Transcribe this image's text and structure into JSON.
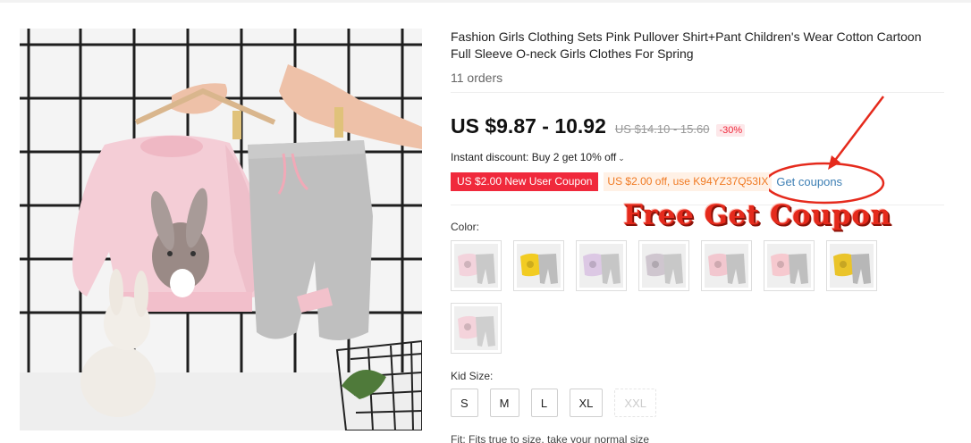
{
  "product": {
    "title": "Fashion Girls Clothing Sets Pink Pullover Shirt+Pant Children's Wear Cotton Cartoon Full Sleeve O-neck Girls Clothes For Spring",
    "orders": "11 orders"
  },
  "price": {
    "current": "US $9.87 - 10.92",
    "original": "US $14.10 - 15.60",
    "discount": "-30%"
  },
  "instant_discount": {
    "text": "Instant discount: Buy 2 get 10% off",
    "caret": "⌄"
  },
  "coupons": {
    "new_user": "US $2.00 New User Coupon",
    "code_offer": "US $2.00 off, use K94YZ37Q53IX",
    "get_coupons": "Get coupons"
  },
  "color": {
    "label": "Color:",
    "options": [
      {
        "name": "pink-rabbit",
        "top": "#f3d3dc",
        "pant": "#c9c9c9"
      },
      {
        "name": "yellow-cat",
        "top": "#f2cc22",
        "pant": "#bdbdbd"
      },
      {
        "name": "purple-rabbit",
        "top": "#dcc8e4",
        "pant": "#c6c6c6"
      },
      {
        "name": "gray",
        "top": "#cfc6cf",
        "pant": "#c8c8c8"
      },
      {
        "name": "pink-plain",
        "top": "#f2c7cf",
        "pant": "#c3c3c3"
      },
      {
        "name": "pink-bear",
        "top": "#f6c9cf",
        "pant": "#bfbfbf"
      },
      {
        "name": "yellow-bear",
        "top": "#eac42a",
        "pant": "#b7b7b7"
      },
      {
        "name": "pink-rabbit-2",
        "top": "#f4d3db",
        "pant": "#cfcfcf"
      }
    ]
  },
  "size": {
    "label": "Kid Size:",
    "options": [
      "S",
      "M",
      "L",
      "XL",
      "XXL"
    ]
  },
  "fit": "Fit: Fits true to size, take your normal size",
  "annotation": {
    "text": "Free Get Coupon",
    "color": "#e52a1c"
  }
}
